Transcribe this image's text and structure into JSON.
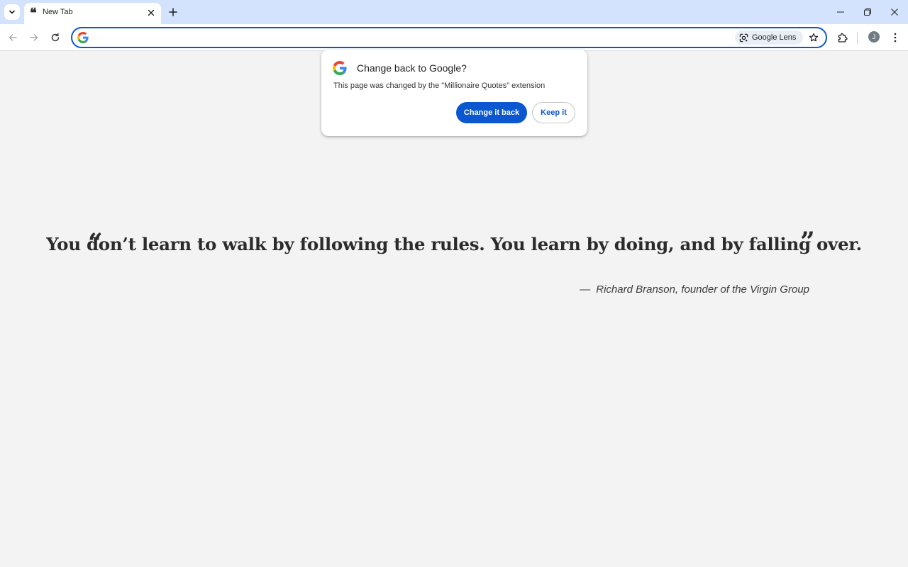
{
  "browser": {
    "tab": {
      "favicon": "❝",
      "title": "New Tab"
    },
    "omnibox": {
      "value": "",
      "placeholder": ""
    },
    "lens_label": "Google Lens",
    "avatar_initial": "J"
  },
  "popup": {
    "title": "Change back to Google?",
    "description": "This page was changed by the \"Millionaire Quotes\" extension",
    "primary_button": "Change it back",
    "secondary_button": "Keep it"
  },
  "quote": {
    "open_mark": "“",
    "close_mark": "”",
    "text": "You don’t learn to walk by following the rules. You learn by doing, and by falling over.",
    "dash": "—",
    "author": "Richard Branson, founder of the Virgin Group"
  },
  "colors": {
    "tabstrip": "#d3e3fd",
    "accent": "#0b57d0",
    "page_background": "#f3f3f3",
    "quote_text": "#2b2b2b"
  },
  "icons": {
    "tab_search": "chevron-down-icon",
    "tab_close": "close-icon",
    "new_tab": "plus-icon",
    "minimize": "minimize-icon",
    "restore": "restore-icon",
    "close_window": "close-icon",
    "back": "arrow-left-icon",
    "forward": "arrow-right-icon",
    "reload": "reload-icon",
    "omnibox": "google-g-icon",
    "lens": "google-lens-icon",
    "bookmark": "star-icon",
    "extensions": "puzzle-icon",
    "menu": "kebab-menu-icon"
  }
}
